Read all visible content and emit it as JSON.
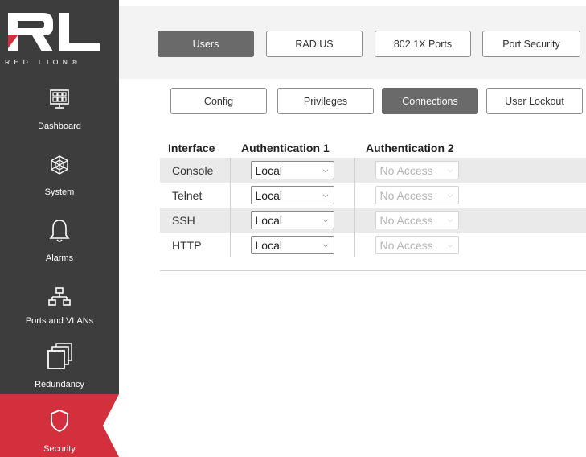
{
  "brand": {
    "logo_text": "RED LION®"
  },
  "sidebar": {
    "items": [
      {
        "label": "Dashboard",
        "icon": "dashboard-icon"
      },
      {
        "label": "System",
        "icon": "system-icon"
      },
      {
        "label": "Alarms",
        "icon": "bell-icon"
      },
      {
        "label": "Ports and VLANs",
        "icon": "network-icon"
      },
      {
        "label": "Redundancy",
        "icon": "redundancy-icon"
      },
      {
        "label": "Security",
        "icon": "shield-icon",
        "active": true
      }
    ]
  },
  "top_tabs": [
    {
      "label": "Users",
      "active": true
    },
    {
      "label": "RADIUS"
    },
    {
      "label": "802.1X Ports"
    },
    {
      "label": "Port Security"
    }
  ],
  "sub_tabs": [
    {
      "label": "Config"
    },
    {
      "label": "Privileges"
    },
    {
      "label": "Connections",
      "active": true
    },
    {
      "label": "User Lockout"
    }
  ],
  "table": {
    "headers": [
      "Interface",
      "Authentication 1",
      "Authentication 2"
    ],
    "rows": [
      {
        "interface": "Console",
        "auth1": "Local",
        "auth2": "No Access"
      },
      {
        "interface": "Telnet",
        "auth1": "Local",
        "auth2": "No Access"
      },
      {
        "interface": "SSH",
        "auth1": "Local",
        "auth2": "No Access"
      },
      {
        "interface": "HTTP",
        "auth1": "Local",
        "auth2": "No Access"
      }
    ]
  },
  "colors": {
    "sidebar": "#3d3d3d",
    "active": "#d32f3c",
    "tab_active": "#6a6a6a"
  }
}
